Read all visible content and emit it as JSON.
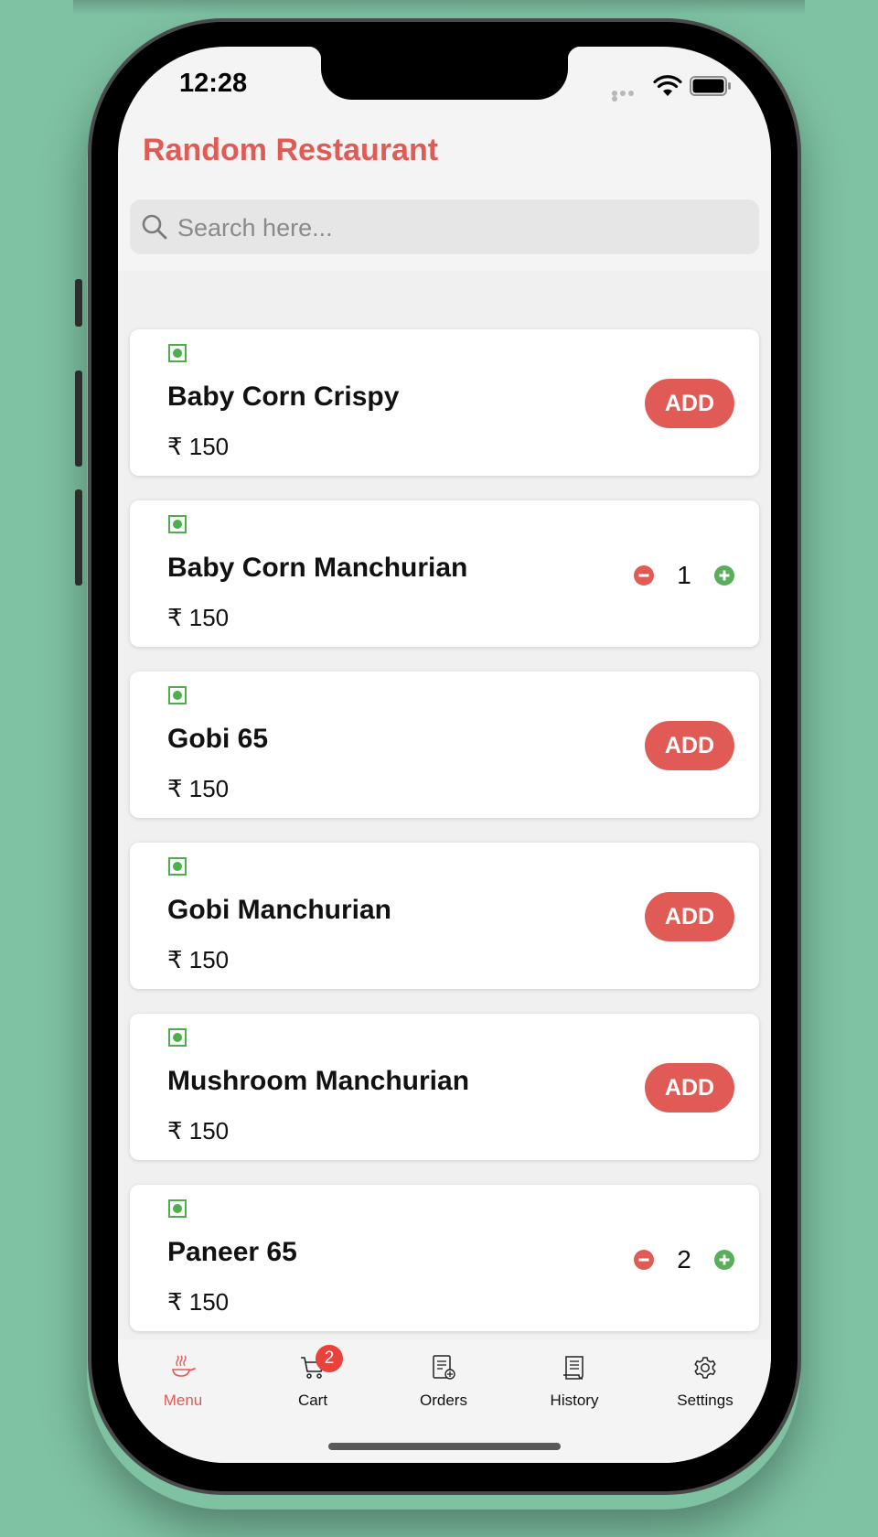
{
  "status_bar": {
    "time": "12:28"
  },
  "header": {
    "title": "Random Restaurant"
  },
  "search": {
    "placeholder": "Search here...",
    "value": ""
  },
  "menu_items": [
    {
      "name": "Baby Corn Crispy",
      "price": "₹ 150",
      "veg": true,
      "in_cart": false,
      "action_label": "ADD"
    },
    {
      "name": "Baby Corn Manchurian",
      "price": "₹ 150",
      "veg": true,
      "in_cart": true,
      "quantity": "1"
    },
    {
      "name": "Gobi 65",
      "price": "₹ 150",
      "veg": true,
      "in_cart": false,
      "action_label": "ADD"
    },
    {
      "name": "Gobi Manchurian",
      "price": "₹ 150",
      "veg": true,
      "in_cart": false,
      "action_label": "ADD"
    },
    {
      "name": "Mushroom Manchurian",
      "price": "₹ 150",
      "veg": true,
      "in_cart": false,
      "action_label": "ADD"
    },
    {
      "name": "Paneer 65",
      "price": "₹ 150",
      "veg": true,
      "in_cart": true,
      "quantity": "2"
    }
  ],
  "tab_bar": {
    "tabs": [
      {
        "label": "Menu",
        "icon": "cooking-pan-icon",
        "active": true
      },
      {
        "label": "Cart",
        "icon": "cart-icon",
        "active": false,
        "badge": "2"
      },
      {
        "label": "Orders",
        "icon": "orders-icon",
        "active": false
      },
      {
        "label": "History",
        "icon": "history-icon",
        "active": false
      },
      {
        "label": "Settings",
        "icon": "gear-icon",
        "active": false
      }
    ]
  },
  "colors": {
    "accent": "#e05b55",
    "veg_indicator": "#4cae4c",
    "increment": "#5aae5a",
    "badge": "#e8423a",
    "background": "#7ec2a2"
  }
}
